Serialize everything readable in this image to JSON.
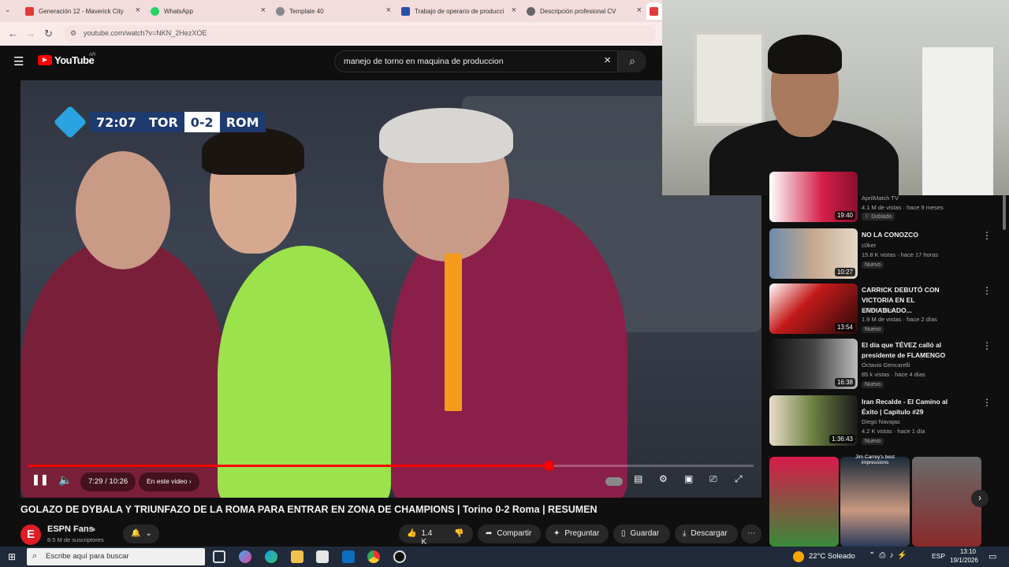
{
  "browser": {
    "tabs": [
      {
        "label": "Generación 12 - Maverick City",
        "color": "#e23b3b"
      },
      {
        "label": "WhatsApp",
        "color": "#25d366"
      },
      {
        "label": "Template 40",
        "color": "#888888"
      },
      {
        "label": "Trabajo de operario de producci",
        "color": "#2a4fa8"
      },
      {
        "label": "Descripción profesional CV",
        "color": "#666666"
      }
    ],
    "url": "youtube.com/watch?v=NKN_2HezXOE"
  },
  "youtube": {
    "logo_text": "YouTube",
    "region": "AR",
    "search_value": "manejo de torno en maquina de produccion"
  },
  "video": {
    "scoreboard": {
      "clock": "72:07",
      "home": "TOR",
      "score": "0-2",
      "away": "ROM"
    },
    "time": "7:29 / 10:26",
    "chapter": "En este video",
    "progress": 0.717,
    "title": "GOLAZO DE DYBALA Y TRIUNFAZO DE LA ROMA PARA ENTRAR EN ZONA DE CHAMPIONS | Torino 0-2 Roma | RESUMEN"
  },
  "channel": {
    "name": "ESPN Fans",
    "subscribers": "8.5 M de suscriptores",
    "likes": "1.4 K",
    "share": "Compartir",
    "ask": "Preguntar",
    "save": "Guardar",
    "download": "Descargar"
  },
  "sidebar": {
    "top_partial": {
      "channel": "AprilMatch TV",
      "meta": "4.1 M de vistas · hace 9 meses",
      "badge": "Doblado",
      "duration": "19:40"
    },
    "videos": [
      {
        "title": "NO LA CONOZCO",
        "channel": "c0ker",
        "meta": "15.8 K vistas · hace 17 horas",
        "badge": "Nuevo",
        "duration": "10:27"
      },
      {
        "title": "CARRICK DEBUTÓ CON VICTORIA EN EL ENDIABLADO...",
        "channel": "ESPN Fans",
        "meta": "1.9 M de vistas · hace 2 días",
        "badge": "Nuevo",
        "duration": "13:54"
      },
      {
        "title": "El día que TÉVEZ calló al presidente de FLAMENGO",
        "channel": "Octavio Gencarelli",
        "meta": "85 k vistas · hace 4 días",
        "badge": "Nuevo",
        "duration": "16:38"
      },
      {
        "title": "Iran Recalde - El Camino al Éxito | Capítulo #29",
        "channel": "Diego Navajas",
        "meta": "4.2 K vistas · hace 1 día",
        "badge": "Nuevo",
        "duration": "1:36:43"
      }
    ],
    "shorts_label": "Jim Carrey's best impressions"
  },
  "taskbar": {
    "search_placeholder": "Escribe aquí para buscar",
    "weather": "22°C  Soleado",
    "lang": "ESP",
    "time": "13:10",
    "date": "19/1/2026"
  }
}
